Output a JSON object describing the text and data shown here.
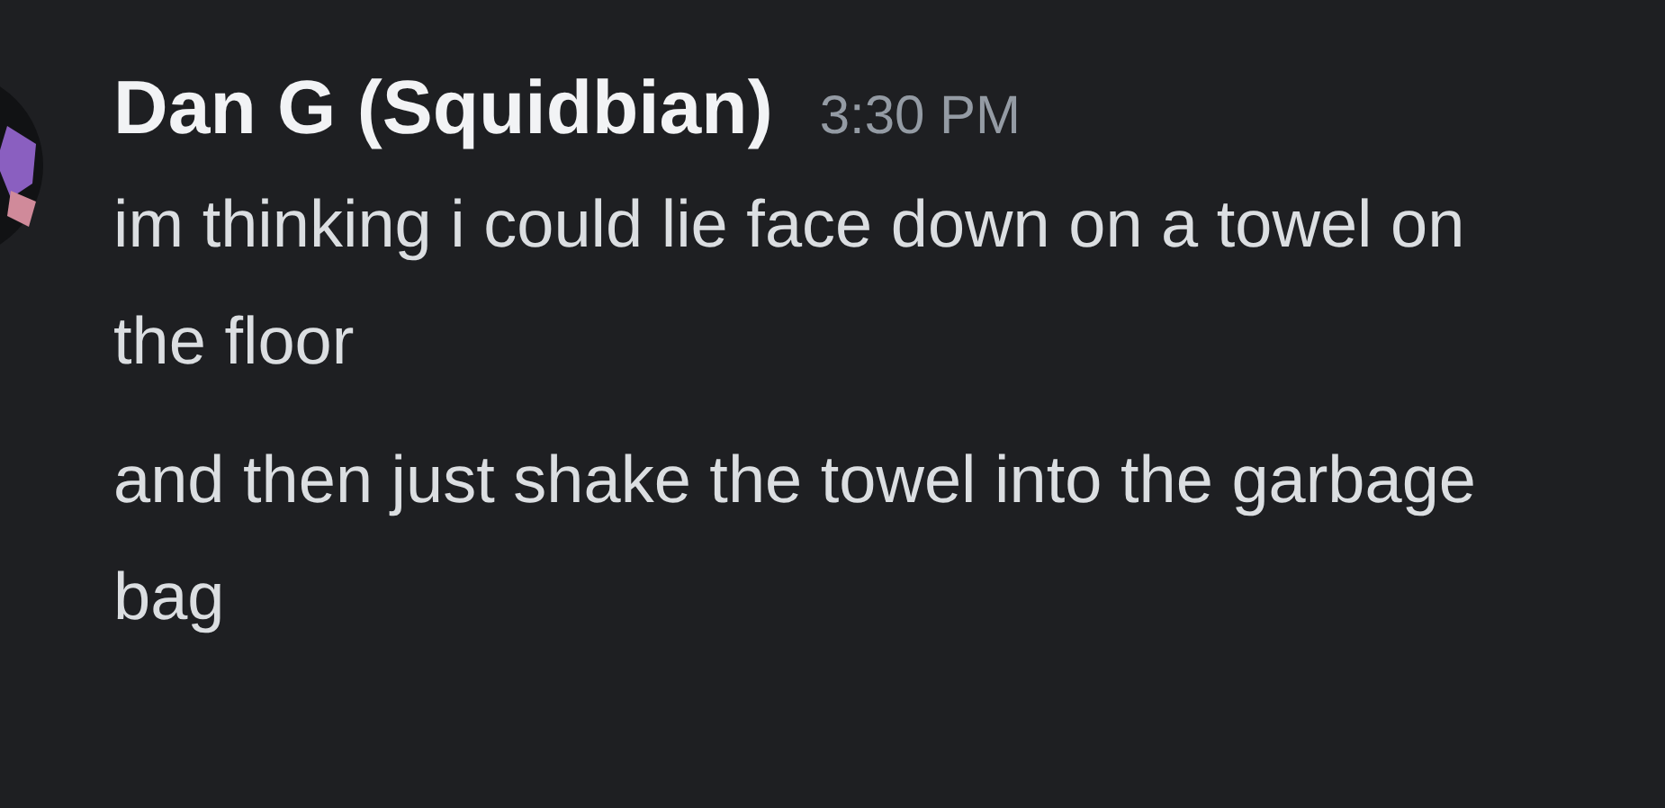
{
  "message_group": {
    "author": "Dan G (Squidbian)",
    "timestamp": "3:30 PM",
    "messages": [
      "im thinking i could lie face down on a towel on the floor",
      "and then just shake the towel into the garbage bag"
    ]
  }
}
